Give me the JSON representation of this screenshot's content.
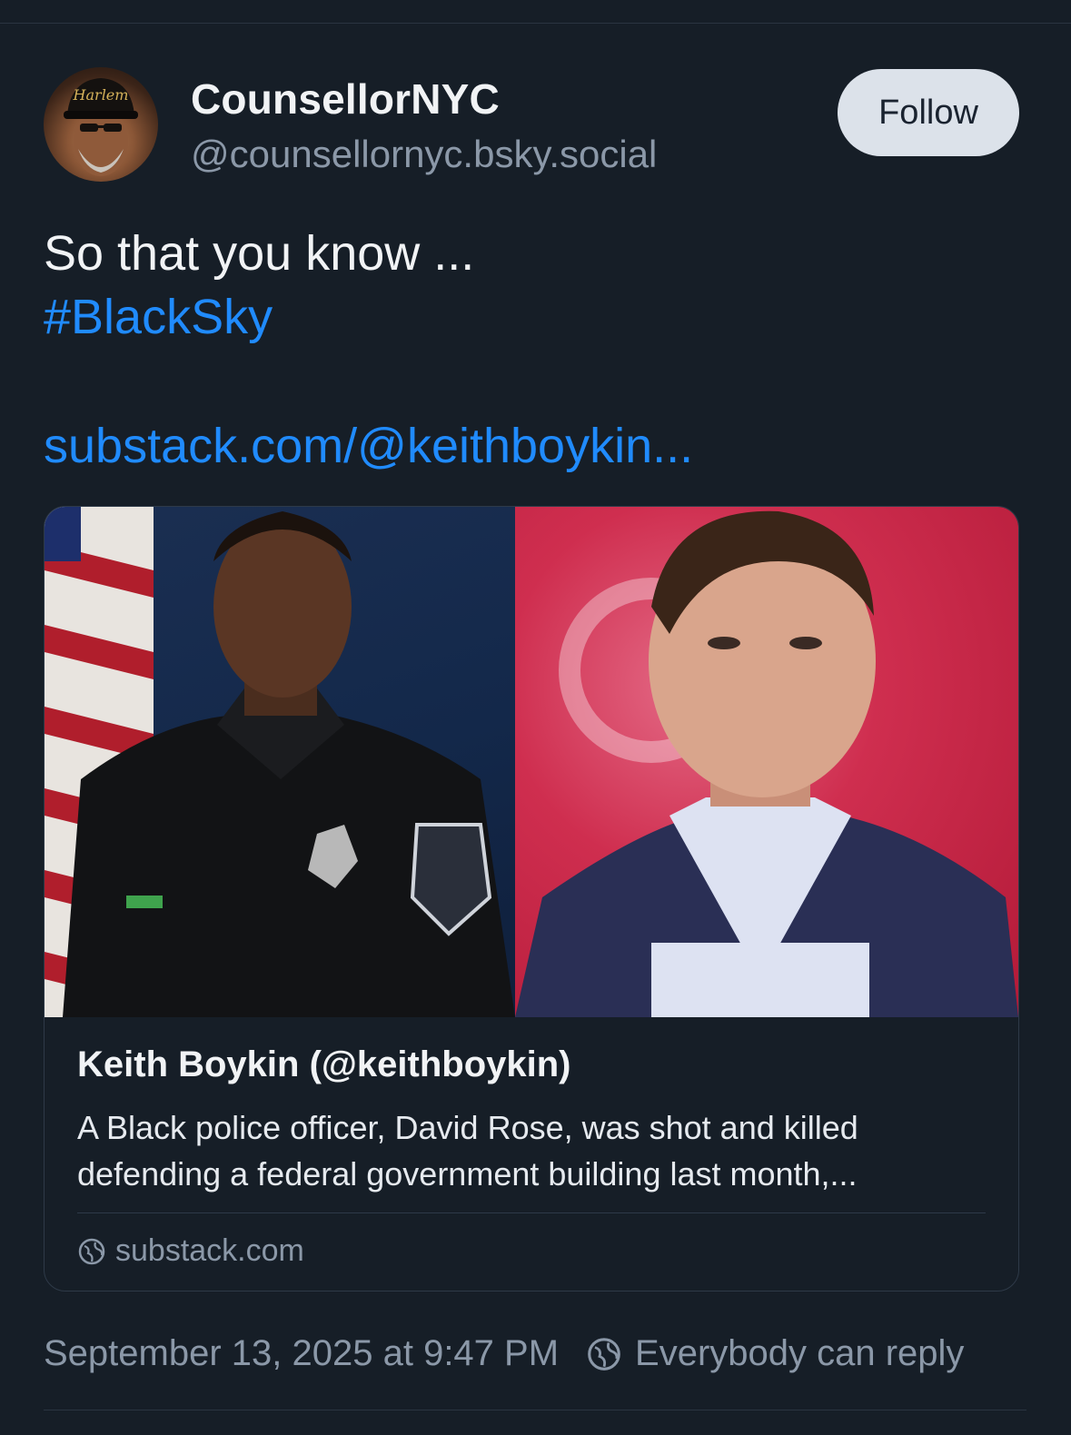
{
  "post": {
    "author": {
      "display_name": "CounsellorNYC",
      "handle": "@counsellornyc.bsky.social",
      "avatar_cap_text": "Harlem"
    },
    "follow_label": "Follow",
    "text": "So that you know ...",
    "hashtag": "#BlackSky",
    "link_text": "substack.com/@keithboykin...",
    "link_card": {
      "title": "Keith Boykin (@keithboykin)",
      "description": "A Black police officer, David Rose, was shot and killed defending a federal government building last month,...",
      "domain": "substack.com"
    },
    "timestamp": "September 13, 2025 at 9:47 PM",
    "reply_setting": "Everybody can reply"
  },
  "colors": {
    "background": "#161e27",
    "link": "#208bfe",
    "muted": "#8b98a8",
    "follow_button_bg": "#dce2ea"
  },
  "icons": {
    "reply_setting": "globe-icon",
    "domain": "globe-icon"
  }
}
